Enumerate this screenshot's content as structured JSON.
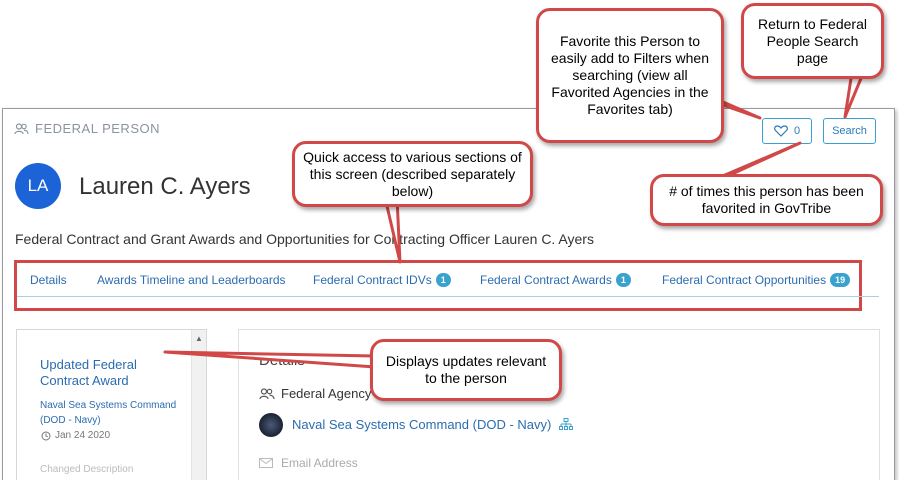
{
  "header": {
    "label": "FEDERAL PERSON",
    "favorite_count": "0",
    "search_label": "Search"
  },
  "person": {
    "initials": "LA",
    "name": "Lauren C. Ayers",
    "subtitle": "Federal Contract and Grant Awards and Opportunities for Contracting Officer Lauren C. Ayers"
  },
  "tabs": [
    {
      "label": "Details",
      "badge": ""
    },
    {
      "label": "Awards Timeline and Leaderboards",
      "badge": ""
    },
    {
      "label": "Federal Contract IDVs",
      "badge": "1"
    },
    {
      "label": "Federal Contract Awards",
      "badge": "1"
    },
    {
      "label": "Federal Contract Opportunities",
      "badge": "19"
    }
  ],
  "updates": {
    "title": "Updated Federal Contract Award",
    "agency": "Naval Sea Systems Command (DOD - Navy)",
    "date": "Jan 24 2020",
    "next": "Changed Description"
  },
  "details": {
    "title": "Details",
    "agency_label": "Federal Agency",
    "agency_name": "Naval Sea Systems Command (DOD - Navy)",
    "email_label": "Email Address"
  },
  "callouts": {
    "favorite": "Favorite this Person to easily add to Filters when searching (view all Favorited Agencies in the Favorites tab)",
    "return": "Return to Federal People Search page",
    "quick": "Quick access to various sections of this screen (described separately below)",
    "count": "# of times this person has been favorited in GovTribe",
    "updates": "Displays updates relevant to the person"
  },
  "colors": {
    "accent": "#2b6cb0",
    "badge": "#3aa2cf",
    "callout_border": "#d04848",
    "avatar": "#1b63d6"
  }
}
